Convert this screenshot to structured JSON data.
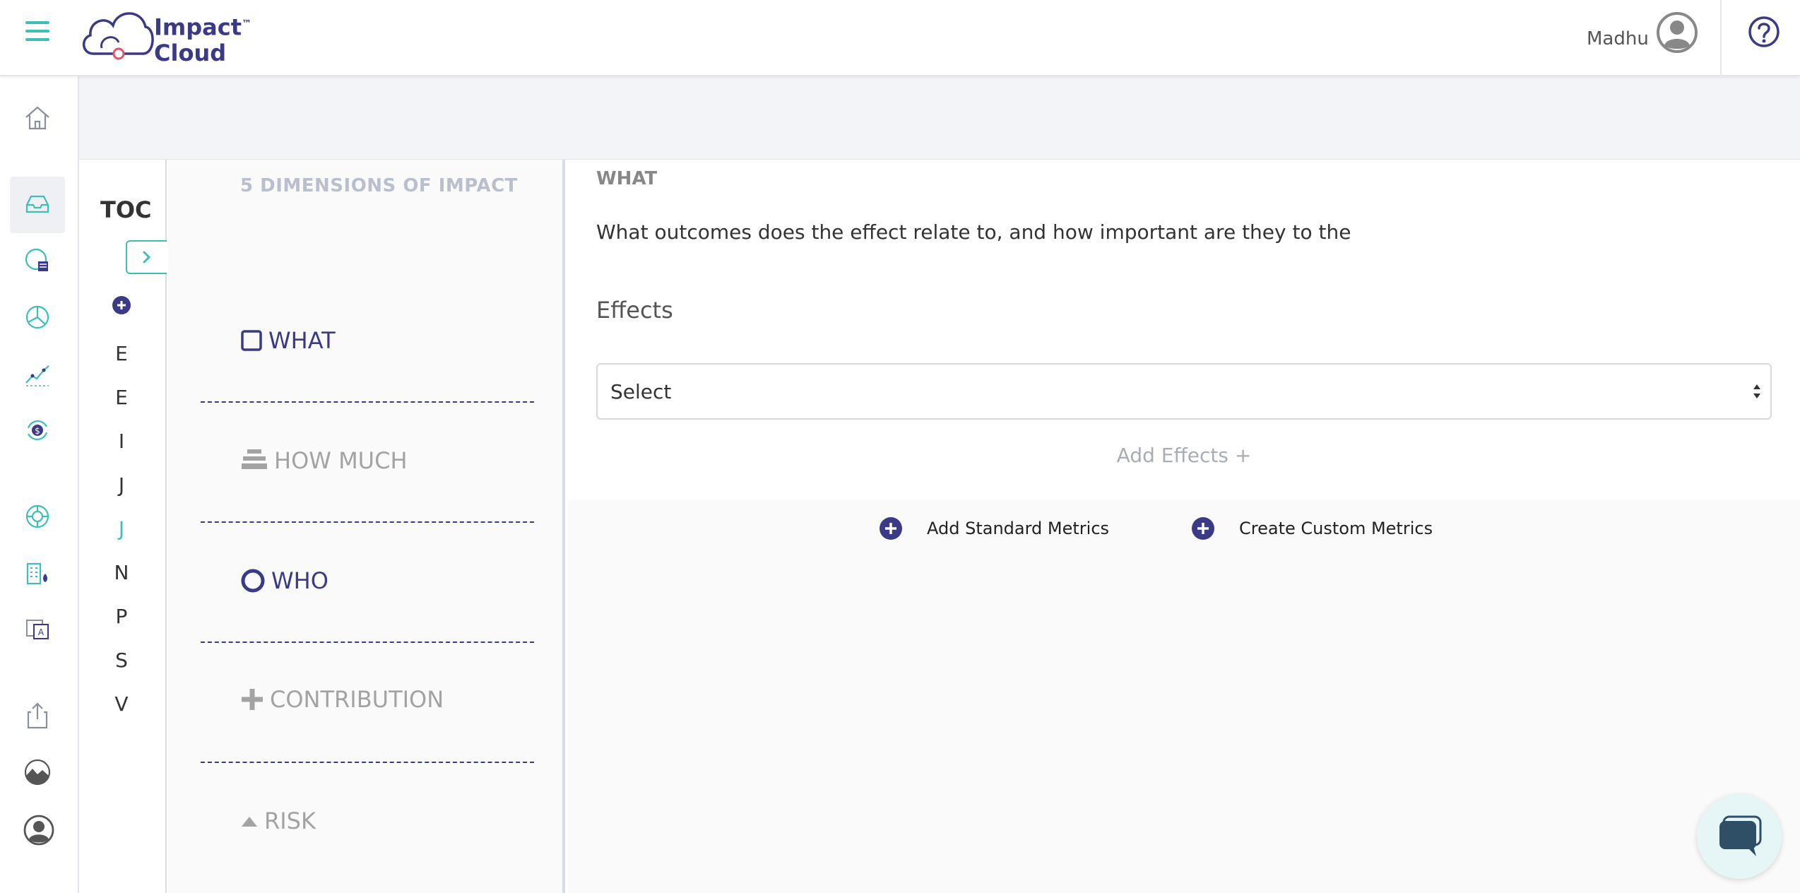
{
  "header": {
    "logo_line1": "Impact",
    "logo_tm": "™",
    "logo_line2": "Cloud",
    "user_name": "Madhu"
  },
  "rail": {
    "icons": [
      "home-icon",
      "inbox-icon",
      "report-icon",
      "pie-chart-icon",
      "trend-icon",
      "currency-cycle-icon",
      "globe-icon",
      "building-icon",
      "translate-icon",
      "export-icon",
      "landscape-icon",
      "profile-icon"
    ]
  },
  "toc": {
    "title": "TOC",
    "letters": [
      "E",
      "E",
      "I",
      "J",
      "J",
      "N",
      "P",
      "S",
      "V"
    ],
    "active_index": 4
  },
  "dimensions": {
    "title": "5 DIMENSIONS OF IMPACT",
    "items": [
      {
        "label": "WHAT",
        "icon": "checkbox-icon",
        "active": true
      },
      {
        "label": "HOW MUCH",
        "icon": "stack-icon",
        "active": false
      },
      {
        "label": "WHO",
        "icon": "circle-icon",
        "active": true
      },
      {
        "label": "CONTRIBUTION",
        "icon": "plus-icon",
        "active": false
      },
      {
        "label": "RISK",
        "icon": "triangle-icon",
        "active": false
      }
    ]
  },
  "main": {
    "section_head": "WHAT",
    "question": "What outcomes does the effect relate to, and how important are they to the",
    "effects_label": "Effects",
    "select_value": "Select",
    "add_effects": "Add Effects +",
    "add_standard_metrics": "Add Standard Metrics",
    "create_custom_metrics": "Create Custom Metrics"
  },
  "colors": {
    "brand_navy": "#3a3a86",
    "accent_teal": "#3dbfb5",
    "muted_gray": "#a3a3a3"
  }
}
